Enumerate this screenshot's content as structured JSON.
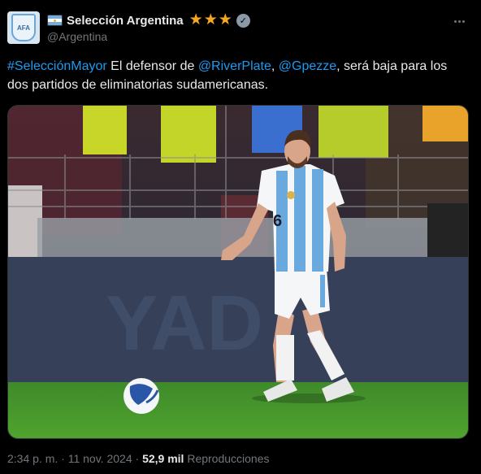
{
  "author": {
    "display_name": "Selección Argentina",
    "handle": "@Argentina",
    "flag_icon": "argentina-flag-icon",
    "badge_stars": [
      "★",
      "★",
      "★"
    ],
    "verified_icon": "verified-badge-icon"
  },
  "tweet": {
    "hashtag": "#SelecciónMayor",
    "text_part1": " El defensor de ",
    "mention1": "@RiverPlate",
    "text_part2": ", ",
    "mention2": "@Gpezze",
    "text_part3": ", será baja para los dos partidos de eliminatorias sudamericanas."
  },
  "media": {
    "description_icon": "match-photo",
    "jersey_number": "6"
  },
  "meta": {
    "time": "2:34 p. m.",
    "separator": " · ",
    "date": "11 nov. 2024",
    "views_count": "52,9 mil",
    "views_label": " Reproducciones"
  },
  "colors": {
    "link": "#1d9bf0",
    "background": "#000000",
    "star": "#f5a623"
  }
}
